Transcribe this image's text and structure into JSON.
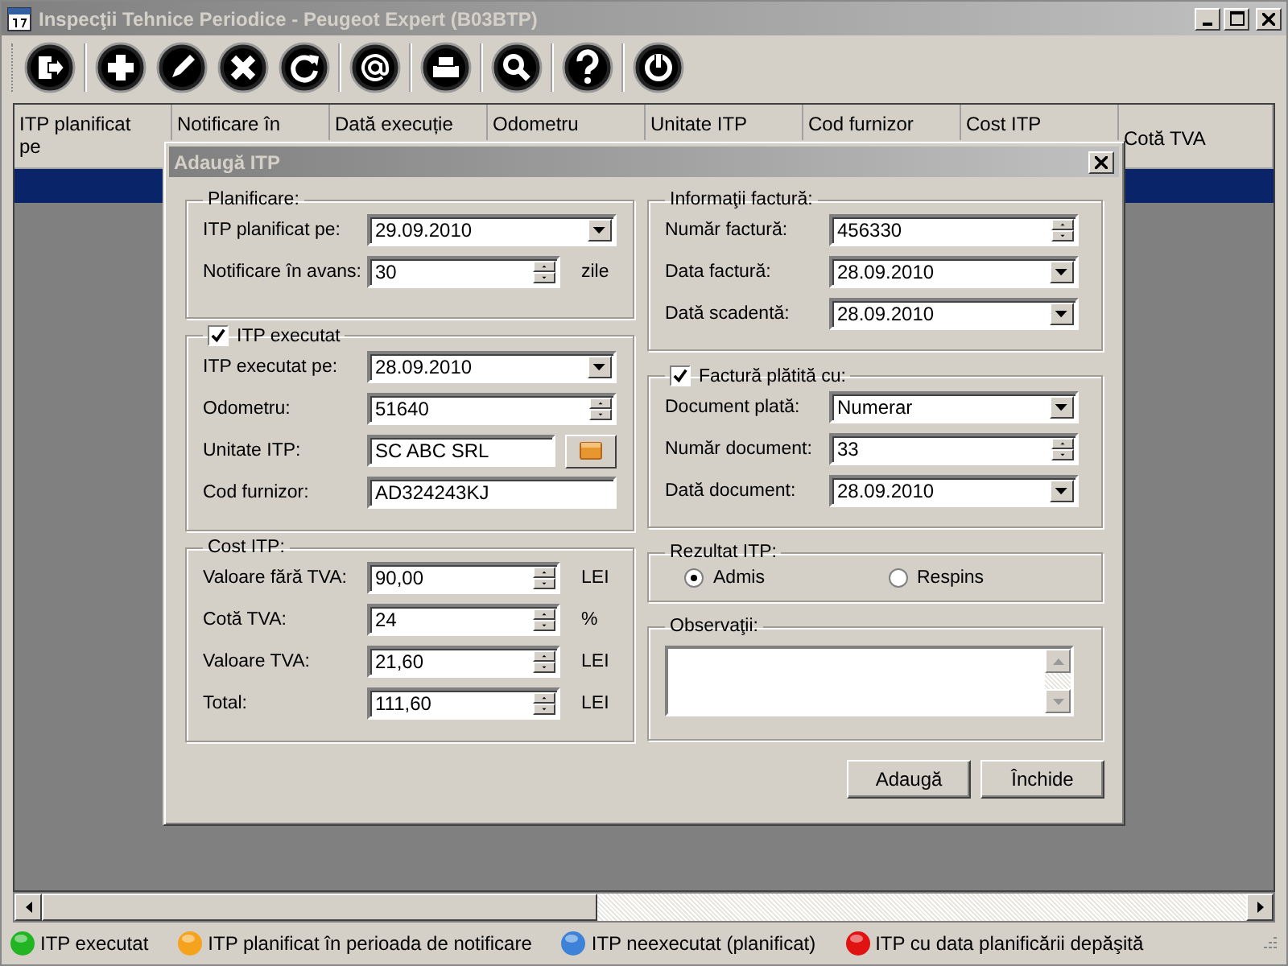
{
  "window": {
    "title": "Inspecţii Tehnice Periodice - Peugeot Expert (B03BTP)"
  },
  "toolbar": {
    "groups": [
      [
        {
          "kind": "exit"
        }
      ],
      [
        {
          "kind": "add"
        },
        {
          "kind": "edit"
        },
        {
          "kind": "delete"
        },
        {
          "kind": "refresh"
        }
      ],
      [
        {
          "kind": "email"
        }
      ],
      [
        {
          "kind": "print"
        }
      ],
      [
        {
          "kind": "search"
        }
      ],
      [
        {
          "kind": "help"
        }
      ],
      [
        {
          "kind": "power"
        }
      ]
    ]
  },
  "table": {
    "columns": [
      "ITP planificat pe",
      "Notificare în",
      "Dată execuție",
      "Odometru",
      "Unitate ITP",
      "Cod furnizor",
      "Cost ITP",
      "Cotă TVA"
    ],
    "rows": [
      {
        "selected": true
      }
    ]
  },
  "dialog": {
    "title": "Adaugă ITP",
    "left": [
      {
        "legend": "Planificare:",
        "rows": [
          {
            "label": "ITP planificat pe:",
            "kind": "date",
            "value": "29.09.2010"
          },
          {
            "label": "Notificare în avans:",
            "kind": "spin",
            "value": "30",
            "unit": "zile"
          }
        ]
      },
      {
        "legend": "ITP executat",
        "checked": true,
        "rows": [
          {
            "label": "ITP executat pe:",
            "kind": "date",
            "value": "28.09.2010"
          },
          {
            "label": "Odometru:",
            "kind": "spin_wide",
            "value": "51640"
          },
          {
            "label": "Unitate ITP:",
            "kind": "lookup",
            "value": "SC ABC SRL"
          },
          {
            "label": "Cod furnizor:",
            "kind": "text",
            "value": "AD324243KJ"
          }
        ]
      },
      {
        "legend": "Cost ITP:",
        "rows": [
          {
            "label": "Valoare fără TVA:",
            "kind": "spin",
            "value": "90,00",
            "unit": "LEI"
          },
          {
            "label": "Cotă TVA:",
            "kind": "spin",
            "value": "24",
            "unit": "%"
          },
          {
            "label": "Valoare TVA:",
            "kind": "spin",
            "value": "21,60",
            "unit": "LEI"
          },
          {
            "label": "Total:",
            "kind": "spin",
            "value": "111,60",
            "unit": "LEI"
          }
        ]
      }
    ],
    "right": [
      {
        "legend": "Informaţii factură:",
        "rows": [
          {
            "label": "Număr factură:",
            "kind": "spin_wide",
            "value": "456330"
          },
          {
            "label": "Data factură:",
            "kind": "date",
            "value": "28.09.2010"
          },
          {
            "label": "Dată scadentă:",
            "kind": "date",
            "value": "28.09.2010"
          }
        ]
      },
      {
        "legend": "Factură plătită cu:",
        "checked": true,
        "rows": [
          {
            "label": "Document plată:",
            "kind": "combo",
            "value": "Numerar"
          },
          {
            "label": "Număr document:",
            "kind": "spin_wide",
            "value": "33"
          },
          {
            "label": "Dată document:",
            "kind": "date",
            "value": "28.09.2010"
          }
        ]
      }
    ],
    "result": {
      "legend": "Rezultat ITP:",
      "options": [
        {
          "label": "Admis",
          "selected": true
        },
        {
          "label": "Respins",
          "selected": false
        }
      ]
    },
    "notes": {
      "legend": "Observaţii:"
    },
    "buttons": [
      "Adaugă",
      "Închide"
    ]
  },
  "legend": [
    {
      "label": "ITP executat",
      "color": "#22b422"
    },
    {
      "label": "ITP planificat în perioada de notificare",
      "color": "#f5a21c"
    },
    {
      "label": "ITP neexecutat (planificat)",
      "color": "#3b82d8"
    },
    {
      "label": "ITP cu data planificării depăşită",
      "color": "#e01212"
    }
  ]
}
